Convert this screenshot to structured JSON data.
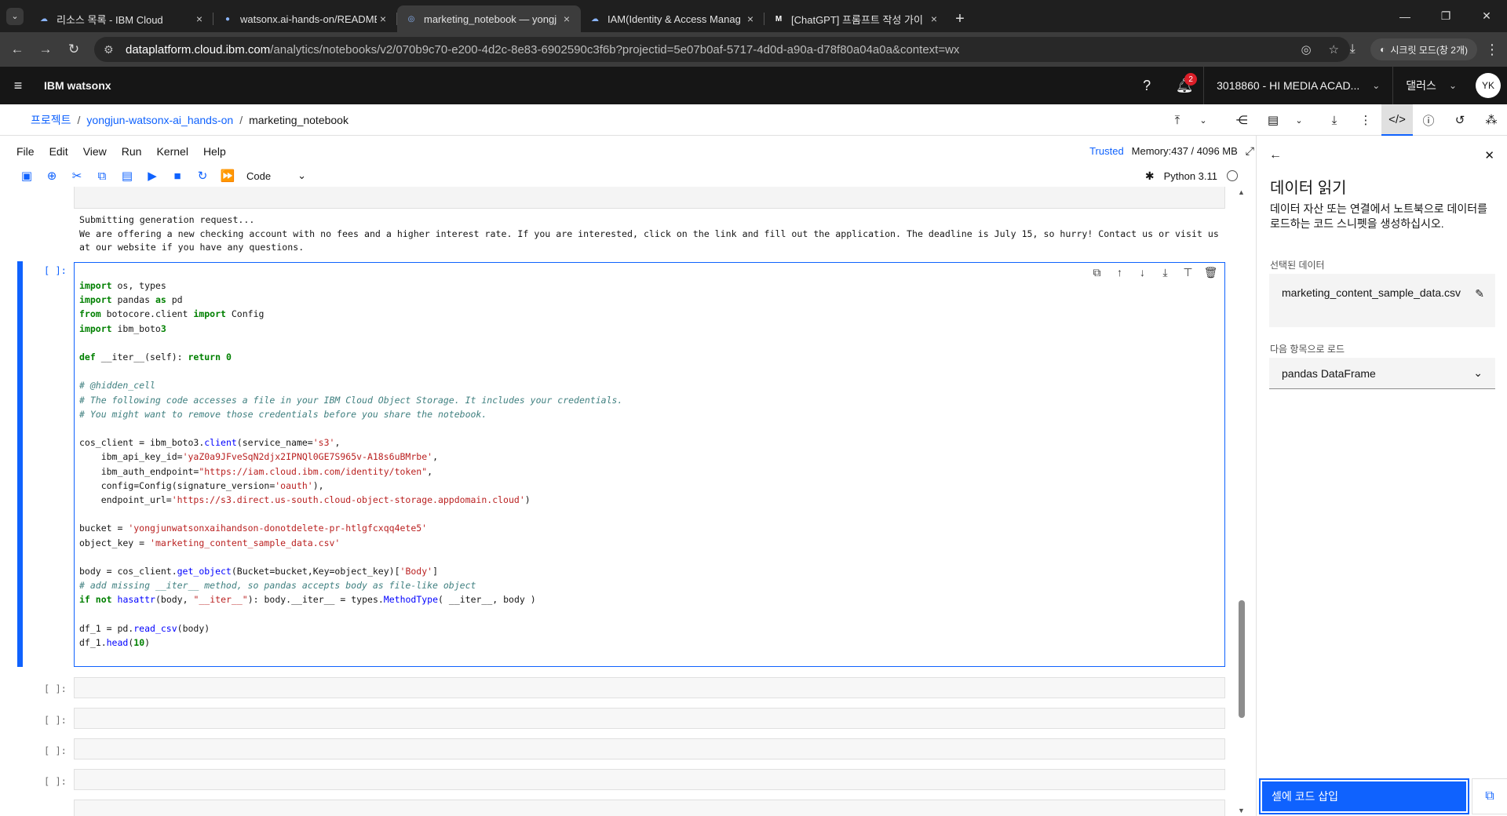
{
  "browser": {
    "tabs": [
      {
        "title": "리소스 목록 - IBM Cloud",
        "active": false
      },
      {
        "title": "watsonx.ai-hands-on/README",
        "active": false
      },
      {
        "title": "marketing_notebook — yongj",
        "active": true
      },
      {
        "title": "IAM(Identity & Access Manag",
        "active": false
      },
      {
        "title": "[ChatGPT] 프롬프트 작성 가이",
        "active": false
      }
    ],
    "url_host": "dataplatform.cloud.ibm.com",
    "url_path": "/analytics/notebooks/v2/070b9c70-e200-4d2c-8e83-6902590c3f6b?projectid=5e07b0af-5717-4d0d-a90a-d78f80a04a0a&context=wx",
    "incognito_label": "시크릿 모드(창 2개)"
  },
  "header": {
    "brand": "IBM watsonx",
    "notification_count": "2",
    "account": "3018860 - HI MEDIA ACAD...",
    "region": "댈러스",
    "avatar": "YK"
  },
  "breadcrumb": {
    "root": "프로젝트",
    "project": "yongjun-watsonx-ai_hands-on",
    "current": "marketing_notebook"
  },
  "menubar": {
    "items": [
      "File",
      "Edit",
      "View",
      "Run",
      "Kernel",
      "Help"
    ],
    "trusted": "Trusted",
    "memory": "Memory:437 / 4096 MB"
  },
  "toolbar": {
    "cell_type": "Code",
    "kernel": "Python 3.11"
  },
  "notebook": {
    "output_text": "Submitting generation request...\nWe are offering a new checking account with no fees and a higher interest rate. If you are interested, click on the link and fill out the application. The deadline is July 15, so hurry! Contact us or visit us at our website if you have any questions.",
    "active_prompt": "[ ]:",
    "empty_prompts": [
      "[ ]:",
      "[ ]:",
      "[ ]:",
      "[ ]:"
    ],
    "code_lines": [
      "import os, types",
      "import pandas as pd",
      "from botocore.client import Config",
      "import ibm_boto3",
      "",
      "def __iter__(self): return 0",
      "",
      "# @hidden_cell",
      "# The following code accesses a file in your IBM Cloud Object Storage. It includes your credentials.",
      "# You might want to remove those credentials before you share the notebook.",
      "",
      "cos_client = ibm_boto3.client(service_name='s3',",
      "    ibm_api_key_id='yaZ0a9JFveSqN2djx2IPNQl0GE7S965v-A18s6uBMrbe',",
      "    ibm_auth_endpoint=\"https://iam.cloud.ibm.com/identity/token\",",
      "    config=Config(signature_version='oauth'),",
      "    endpoint_url='https://s3.direct.us-south.cloud-object-storage.appdomain.cloud')",
      "",
      "bucket = 'yongjunwatsonxaihandson-donotdelete-pr-htlgfcxqq4ete5'",
      "object_key = 'marketing_content_sample_data.csv'",
      "",
      "body = cos_client.get_object(Bucket=bucket,Key=object_key)['Body']",
      "# add missing __iter__ method, so pandas accepts body as file-like object",
      "if not hasattr(body, \"__iter__\"): body.__iter__ = types.MethodType( __iter__, body )",
      "",
      "df_1 = pd.read_csv(body)",
      "df_1.head(10)"
    ]
  },
  "side_panel": {
    "title": "데이터 읽기",
    "description": "데이터 자산 또는 연결에서 노트북으로 데이터를 로드하는 코드 스니펫을 생성하십시오.",
    "selected_label": "선택된 데이터",
    "selected_file": "marketing_content_sample_data.csv",
    "load_as_label": "다음 항목으로 로드",
    "load_as_value": "pandas DataFrame",
    "insert_button": "셀에 코드 삽입"
  }
}
